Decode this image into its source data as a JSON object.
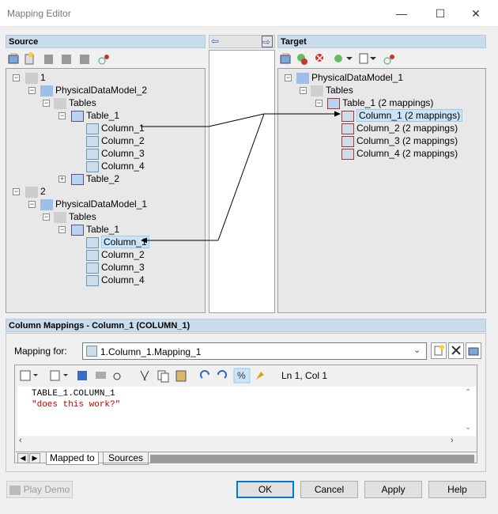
{
  "window": {
    "title": "Mapping Editor",
    "minimize": "—",
    "maximize": "☐",
    "close": "✕"
  },
  "source": {
    "header": "Source"
  },
  "target": {
    "header": "Target"
  },
  "middle": {
    "left_arrow": "⇦",
    "right_arrow": "⇨"
  },
  "source_tree": {
    "n1": "1",
    "pdm2": "PhysicalDataModel_2",
    "tables1": "Tables",
    "table1a": "Table_1",
    "c1a": "Column_1",
    "c2a": "Column_2",
    "c3a": "Column_3",
    "c4a": "Column_4",
    "table2": "Table_2",
    "n2": "2",
    "pdm1": "PhysicalDataModel_1",
    "tables2": "Tables",
    "table1b": "Table_1",
    "c1b": "Column_1",
    "c2b": "Column_2",
    "c3b": "Column_3",
    "c4b": "Column_4"
  },
  "target_tree": {
    "pdm": "PhysicalDataModel_1",
    "tables": "Tables",
    "table": "Table_1 (2 mappings)",
    "c1": "Column_1 (2 mappings)",
    "c2": "Column_2 (2 mappings)",
    "c3": "Column_3 (2 mappings)",
    "c4": "Column_4 (2 mappings)"
  },
  "mappings": {
    "header": "Column Mappings - Column_1 (COLUMN_1)",
    "mapping_for_label": "Mapping for:",
    "mapping_value": "1.Column_1.Mapping_1"
  },
  "editor": {
    "position": "Ln 1, Col 1",
    "line1": "TABLE_1.COLUMN_1",
    "line2": "\"does this work?\""
  },
  "tabs": {
    "mapped_to": "Mapped to",
    "sources": "Sources"
  },
  "buttons": {
    "play_demo": "Play Demo",
    "ok": "OK",
    "cancel": "Cancel",
    "apply": "Apply",
    "help": "Help"
  }
}
